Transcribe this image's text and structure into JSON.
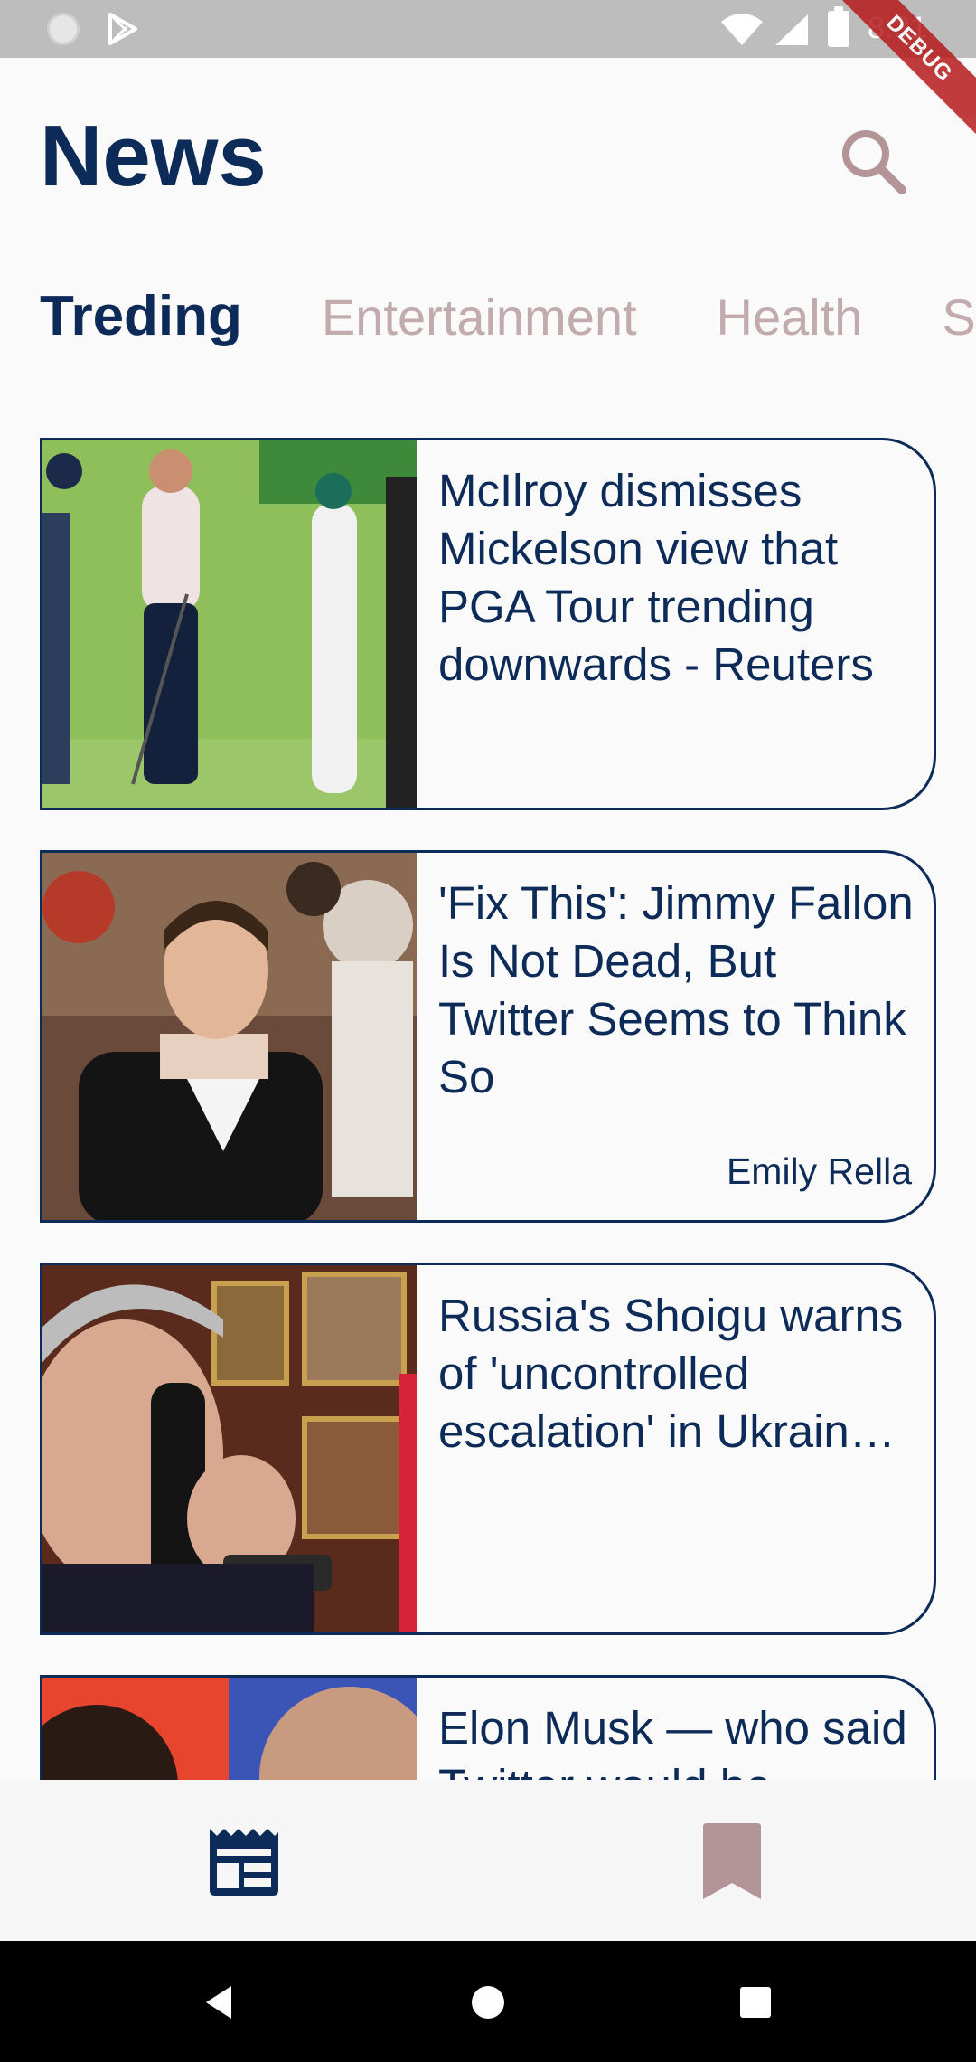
{
  "status_bar": {
    "time": "8:31"
  },
  "debug_banner": "DEBUG",
  "header": {
    "title": "News",
    "search_icon": "search-icon"
  },
  "tabs": [
    {
      "label": "Treding",
      "active": true
    },
    {
      "label": "Entertainment",
      "active": false
    },
    {
      "label": "Health",
      "active": false
    },
    {
      "label": "S",
      "active": false
    }
  ],
  "articles": [
    {
      "title": "McIlroy dismisses Mickelson view that PGA Tour trending downwards - Reuters",
      "author": ""
    },
    {
      "title": "'Fix This': Jimmy Fallon Is Not Dead, But Twitter Seems to Think So",
      "author": "Emily Rella"
    },
    {
      "title": "Russia's Shoigu warns of 'uncontrolled escalation' in Ukrain…",
      "author": ""
    },
    {
      "title": "Elon Musk — who said Twitter would be",
      "author": ""
    }
  ],
  "bottom_nav": [
    {
      "icon": "newspaper-icon",
      "active": true
    },
    {
      "icon": "bookmark-icon",
      "active": false
    }
  ],
  "colors": {
    "primary": "#0d2b59",
    "inactive": "#c2abad"
  }
}
